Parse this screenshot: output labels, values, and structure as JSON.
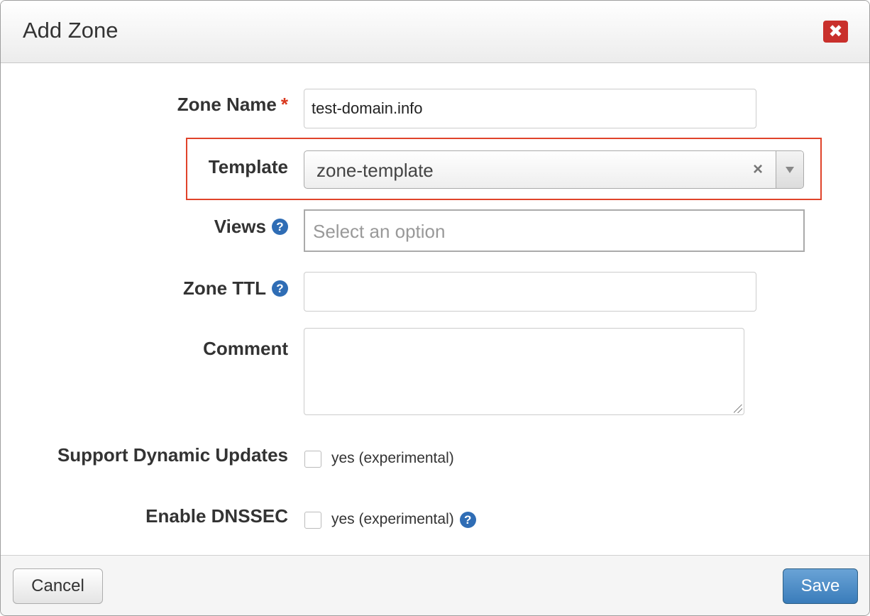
{
  "dialog": {
    "title": "Add Zone",
    "close_icon": "close-icon",
    "close_glyph": "✖"
  },
  "form": {
    "zone_name": {
      "label": "Zone Name",
      "required_mark": "*",
      "value": "test-domain.info"
    },
    "template": {
      "label": "Template",
      "selected": "zone-template",
      "clear_glyph": "×"
    },
    "views": {
      "label": "Views",
      "placeholder": "Select an option",
      "help_glyph": "?"
    },
    "zone_ttl": {
      "label": "Zone TTL",
      "value": "",
      "help_glyph": "?"
    },
    "comment": {
      "label": "Comment",
      "value": ""
    },
    "dynamic_updates": {
      "label": "Support Dynamic Updates",
      "checkbox_label": "yes (experimental)",
      "checked": false
    },
    "dnssec": {
      "label": "Enable DNSSEC",
      "checkbox_label": "yes (experimental)",
      "checked": false,
      "help_glyph": "?"
    }
  },
  "footer": {
    "cancel_label": "Cancel",
    "save_label": "Save"
  },
  "colors": {
    "close_button": "#c9302c",
    "highlight_border": "#e0432a",
    "help_icon": "#2f6db5",
    "save_button": "#3a7cba",
    "required_star": "#d9381e"
  }
}
